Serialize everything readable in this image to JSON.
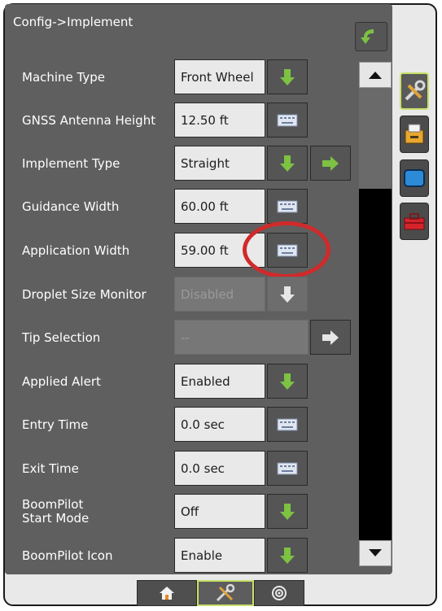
{
  "header": {
    "title": "Config->Implement",
    "back_icon": "back-arrow-icon"
  },
  "rows": [
    {
      "label": "Machine Type",
      "value": "Front Wheel",
      "control": "dropdown",
      "enabled": true
    },
    {
      "label": "GNSS Antenna Height",
      "value": "12.50 ft",
      "control": "keyboard",
      "enabled": true
    },
    {
      "label": "Implement Type",
      "value": "Straight",
      "control": "dropdown",
      "enabled": true,
      "extra": "next-arrow"
    },
    {
      "label": "Guidance Width",
      "value": "60.00 ft",
      "control": "keyboard",
      "enabled": true
    },
    {
      "label": "Application Width",
      "value": "59.00 ft",
      "control": "keyboard",
      "enabled": true,
      "highlighted": true
    },
    {
      "label": "Droplet Size Monitor",
      "value": "Disabled",
      "control": "dropdown",
      "enabled": false
    },
    {
      "label": "Tip Selection",
      "value": "--",
      "control": "next-arrow",
      "enabled": false
    },
    {
      "label": "Applied Alert",
      "value": "Enabled",
      "control": "dropdown",
      "enabled": true
    },
    {
      "label": "Entry Time",
      "value": "0.0 sec",
      "control": "keyboard",
      "enabled": true
    },
    {
      "label": "Exit Time",
      "value": "0.0 sec",
      "control": "keyboard",
      "enabled": true
    },
    {
      "label_line1": "BoomPilot",
      "label_line2": "Start Mode",
      "value": "Off",
      "control": "dropdown",
      "enabled": true
    },
    {
      "label": "BoomPilot Icon",
      "value": "Enable",
      "control": "dropdown",
      "enabled": true
    }
  ],
  "side_tabs": [
    "tools-icon",
    "printer-icon",
    "display-icon",
    "toolbox-icon"
  ],
  "bottom_tabs": [
    "home-icon",
    "tools-icon",
    "gps-icon"
  ],
  "colors": {
    "accent_green": "#7dc242",
    "highlight_ring": "#d12a2a",
    "active_tab_border": "#c7e06a"
  }
}
